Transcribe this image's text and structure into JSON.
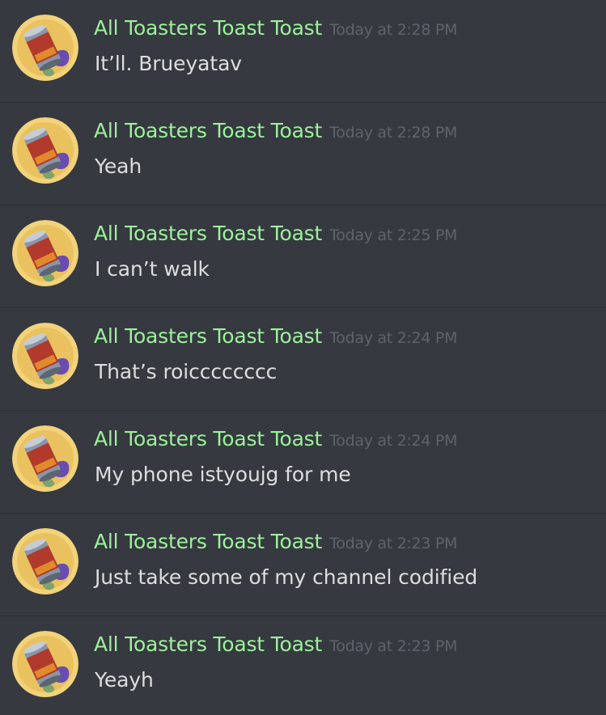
{
  "colors": {
    "background": "#36393f",
    "username": "#9cf19c",
    "timestamp": "#5f636b",
    "message_text": "#dcddde",
    "divider": "#2c2f33"
  },
  "avatar_icon": "canned-coochie-avatar-icon",
  "avatar_text": "CANNED COOCHIE",
  "messages": [
    {
      "username": "All Toasters Toast Toast",
      "timestamp": "Today at 2:28 PM",
      "text": "It’ll. Brueyatav"
    },
    {
      "username": "All Toasters Toast Toast",
      "timestamp": "Today at 2:28 PM",
      "text": "Yeah"
    },
    {
      "username": "All Toasters Toast Toast",
      "timestamp": "Today at 2:25 PM",
      "text": "I can’t walk"
    },
    {
      "username": "All Toasters Toast Toast",
      "timestamp": "Today at 2:24 PM",
      "text": "That’s roicccccccc"
    },
    {
      "username": "All Toasters Toast Toast",
      "timestamp": "Today at 2:24 PM",
      "text": "My phone istyoujg for me"
    },
    {
      "username": "All Toasters Toast Toast",
      "timestamp": "Today at 2:23 PM",
      "text": "Just take some of my channel codified"
    },
    {
      "username": "All Toasters Toast Toast",
      "timestamp": "Today at 2:23 PM",
      "text": "Yeayh"
    }
  ]
}
